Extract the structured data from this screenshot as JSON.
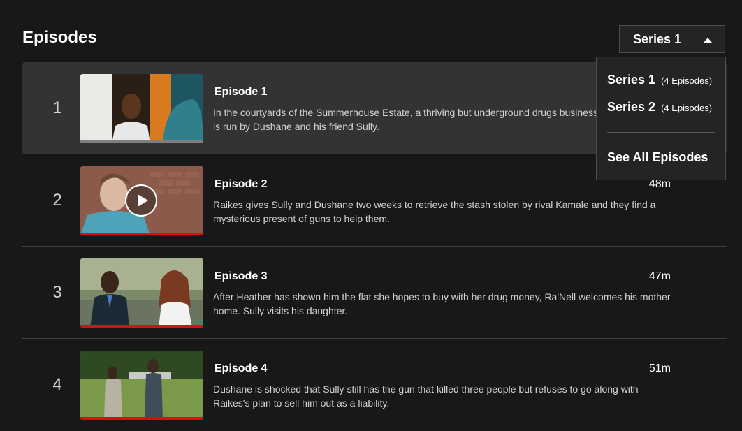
{
  "header": {
    "title": "Episodes"
  },
  "season_select": {
    "selected": "Series 1",
    "icon": "caret-up-icon"
  },
  "dropdown": {
    "options": [
      {
        "name": "Series 1",
        "count": "(4 Episodes)"
      },
      {
        "name": "Series 2",
        "count": "(4 Episodes)"
      }
    ],
    "see_all": "See All Episodes"
  },
  "episodes": [
    {
      "index": "1",
      "title": "Episode 1",
      "duration": "",
      "description": "In the courtyards of the Summerhouse Estate, a thriving but underground drugs business is run by Dushane and his friend Sully.",
      "progress": 0,
      "active": true
    },
    {
      "index": "2",
      "title": "Episode 2",
      "duration": "48m",
      "description": "Raikes gives Sully and Dushane two weeks to retrieve the stash stolen by rival Kamale and they find a mysterious present of guns to help them.",
      "progress": 1.0
    },
    {
      "index": "3",
      "title": "Episode 3",
      "duration": "47m",
      "description": "After Heather has shown him the flat she hopes to buy with her drug money, Ra'Nell welcomes his mother home. Sully visits his daughter.",
      "progress": 1.0
    },
    {
      "index": "4",
      "title": "Episode 4",
      "duration": "51m",
      "description": "Dushane is shocked that Sully still has the gun that killed three people but refuses to go along with Raikes's plan to sell him out as a liability.",
      "progress": 1.0
    }
  ],
  "colors": {
    "accent": "#e50914",
    "background": "#181818",
    "active_row": "#333333"
  }
}
